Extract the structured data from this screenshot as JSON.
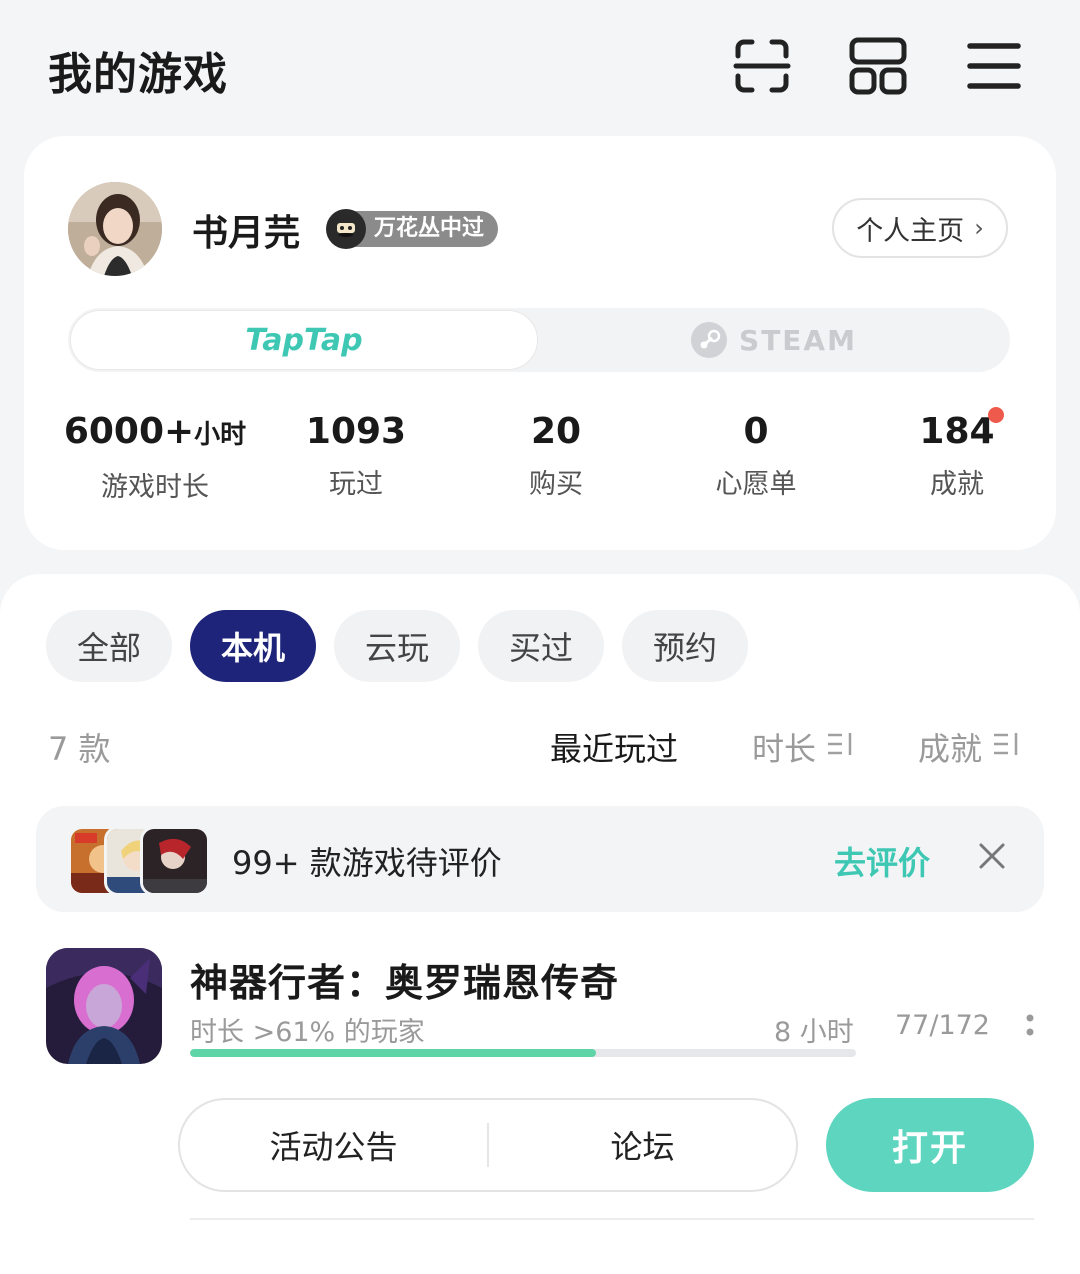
{
  "header": {
    "title": "我的游戏",
    "icons": [
      "scan-icon",
      "layout-icon",
      "menu-icon"
    ]
  },
  "profile": {
    "username": "书月芫",
    "badge_label": "万花丛中过",
    "homepage_label": "个人主页",
    "platforms": [
      {
        "label": "TapTap",
        "selected": true
      },
      {
        "label": "STEAM",
        "selected": false
      }
    ],
    "stats": [
      {
        "value": "6000+",
        "unit": "小时",
        "label": "游戏时长"
      },
      {
        "value": "1093",
        "unit": "",
        "label": "玩过"
      },
      {
        "value": "20",
        "unit": "",
        "label": "购买"
      },
      {
        "value": "0",
        "unit": "",
        "label": "心愿单"
      },
      {
        "value": "184",
        "unit": "",
        "label": "成就",
        "has_notification": true
      }
    ]
  },
  "games": {
    "filter_tabs": [
      {
        "label": "全部",
        "active": false
      },
      {
        "label": "本机",
        "active": true
      },
      {
        "label": "云玩",
        "active": false
      },
      {
        "label": "买过",
        "active": false
      },
      {
        "label": "预约",
        "active": false
      }
    ],
    "count_label": "7 款",
    "sort_options": [
      {
        "label": "最近玩过",
        "active": true
      },
      {
        "label": "时长",
        "active": false
      },
      {
        "label": "成就",
        "active": false
      }
    ],
    "review_banner": {
      "text": "99+ 款游戏待评价",
      "action_label": "去评价"
    },
    "items": [
      {
        "title": "神器行者：奥罗瑞恩传奇",
        "meta": "时长 >61% 的玩家",
        "hours": "8 小时",
        "achievements": "77/172",
        "progress": 0.61,
        "actions": [
          "活动公告",
          "论坛"
        ],
        "open_label": "打开"
      }
    ]
  },
  "colors": {
    "accent": "#3ec8b4",
    "open_button": "#5dd5bf",
    "active_tab": "#1d2479",
    "progress": "#5fd4a6",
    "notification": "#ee5a4b"
  }
}
